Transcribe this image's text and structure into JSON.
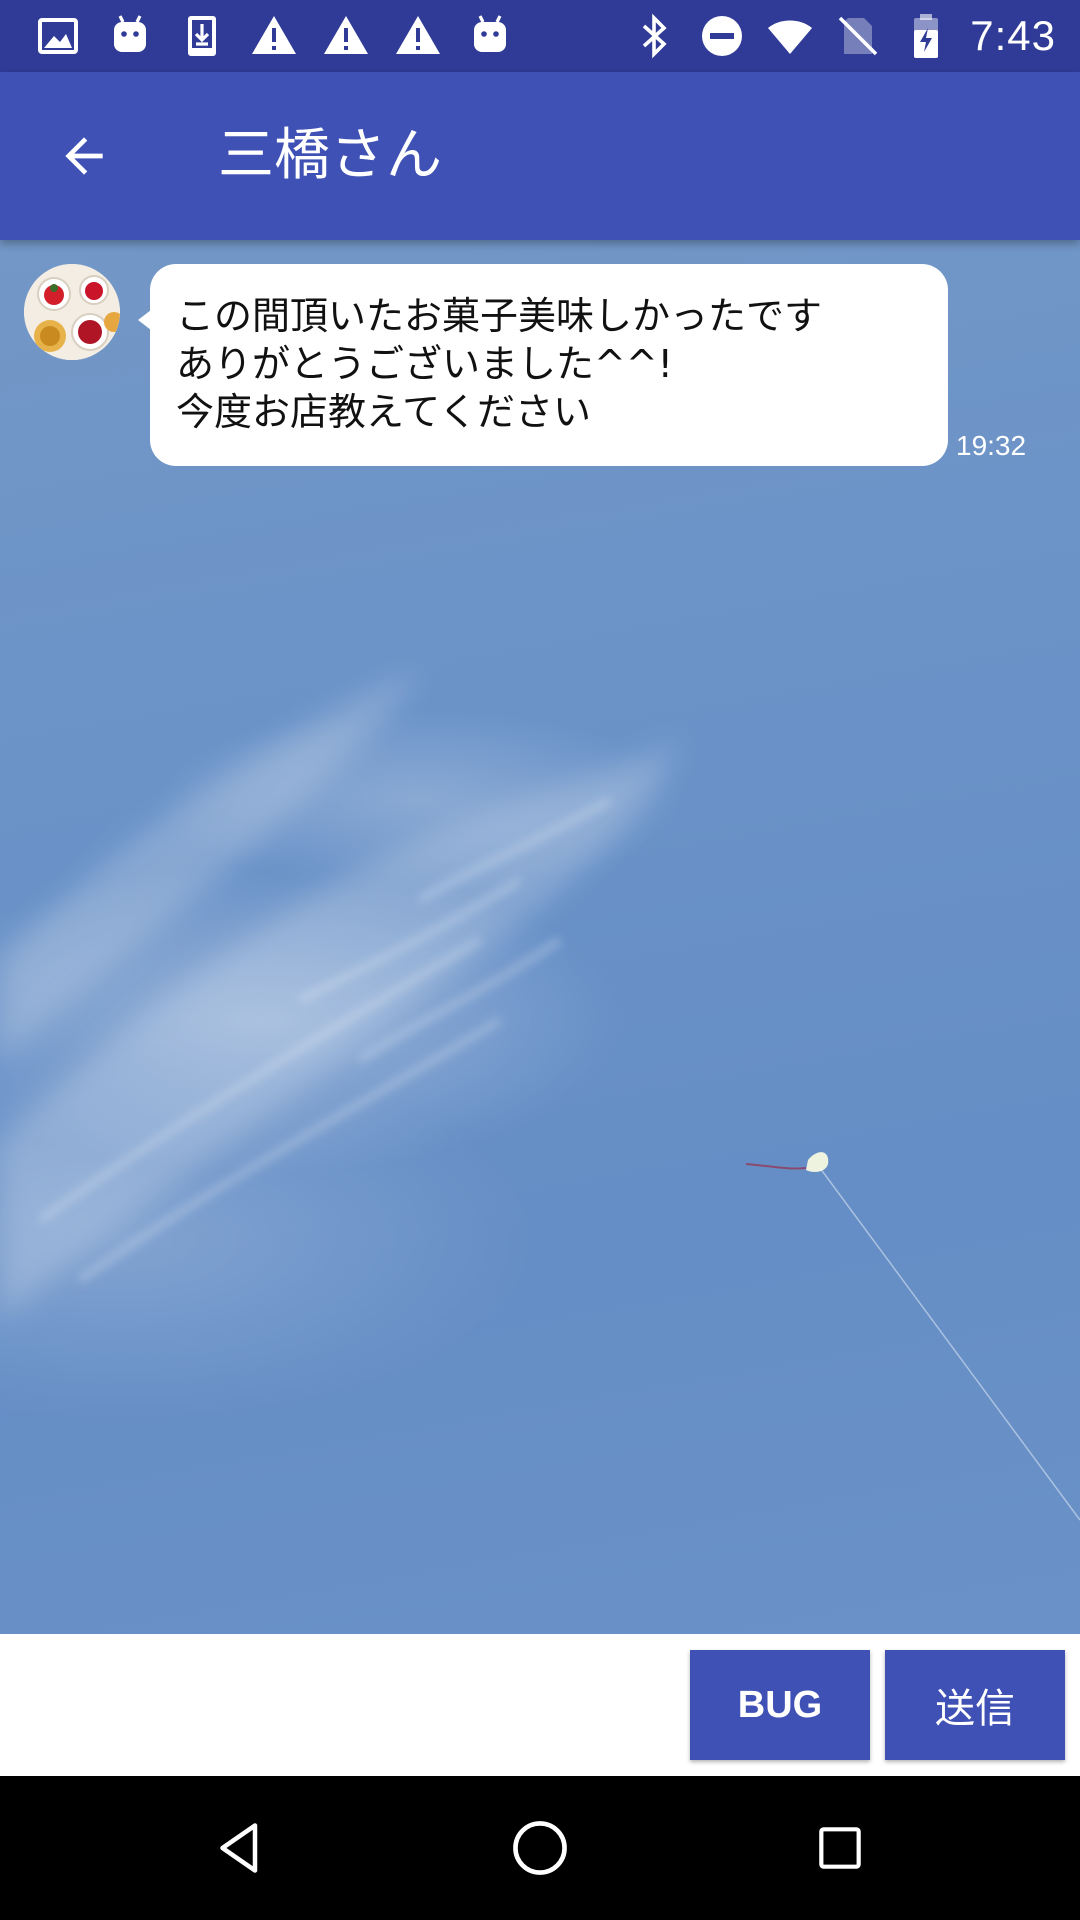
{
  "status_bar": {
    "time": "7:43",
    "left_icons": [
      "image-icon",
      "android-icon",
      "download-icon",
      "warning-icon",
      "warning-icon",
      "warning-icon",
      "android-icon"
    ],
    "right_icons": [
      "bluetooth-icon",
      "do-not-disturb-icon",
      "wifi-icon",
      "no-sim-icon",
      "battery-charging-icon"
    ],
    "color": "#2f3b97"
  },
  "app_bar": {
    "title": "三橋さん",
    "back_icon": "arrow-back-icon",
    "color": "#3f51b5"
  },
  "conversation": {
    "messages": [
      {
        "lines": [
          "この間頂いたお菓子美味しかったです",
          "ありがとうございました^^!",
          "今度お店教えてください"
        ],
        "time": "19:32",
        "avatar_icon": "sweets-avatar"
      }
    ]
  },
  "composer": {
    "input_value": "",
    "bug_label": "BUG",
    "send_label": "送信",
    "button_color": "#3f51b5"
  },
  "nav_bar": {
    "icons": [
      "back-triangle-icon",
      "home-circle-icon",
      "recents-square-icon"
    ]
  }
}
